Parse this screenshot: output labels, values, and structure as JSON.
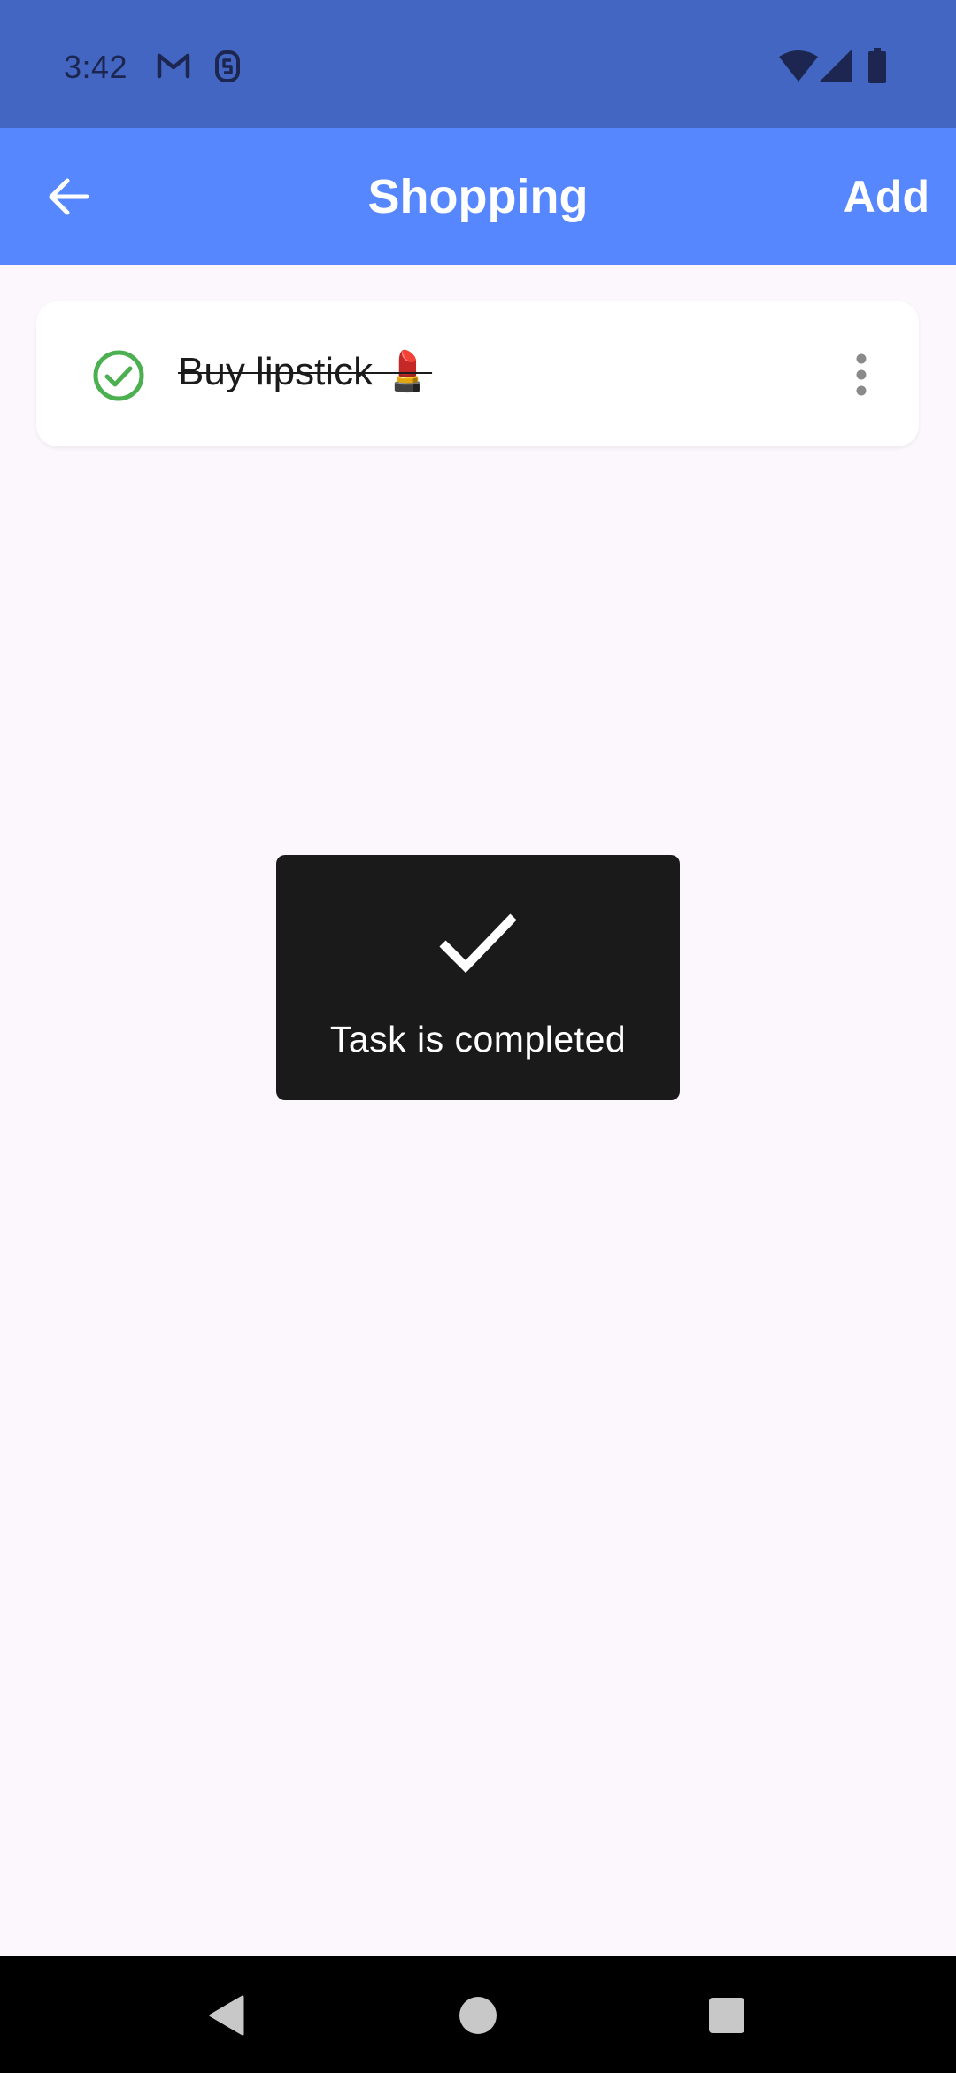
{
  "status_bar": {
    "time": "3:42",
    "background": "#4266c1",
    "icons": [
      "gmail-icon",
      "notification-s-icon",
      "wifi-icon",
      "cellular-signal-icon",
      "battery-icon"
    ]
  },
  "app_bar": {
    "background": "#5787ff",
    "back_icon": "arrow-left-icon",
    "title": "Shopping",
    "add_label": "Add"
  },
  "tasks": [
    {
      "text": "Buy lipstick 💄",
      "completed": true,
      "status_icon": "check-circle-icon",
      "status_color": "#4caf50",
      "menu_icon": "more-vertical-icon"
    }
  ],
  "toast": {
    "icon": "checkmark-icon",
    "message": "Task is completed"
  },
  "nav_bar": {
    "buttons": [
      "back-triangle-icon",
      "home-circle-icon",
      "recents-square-icon"
    ]
  }
}
